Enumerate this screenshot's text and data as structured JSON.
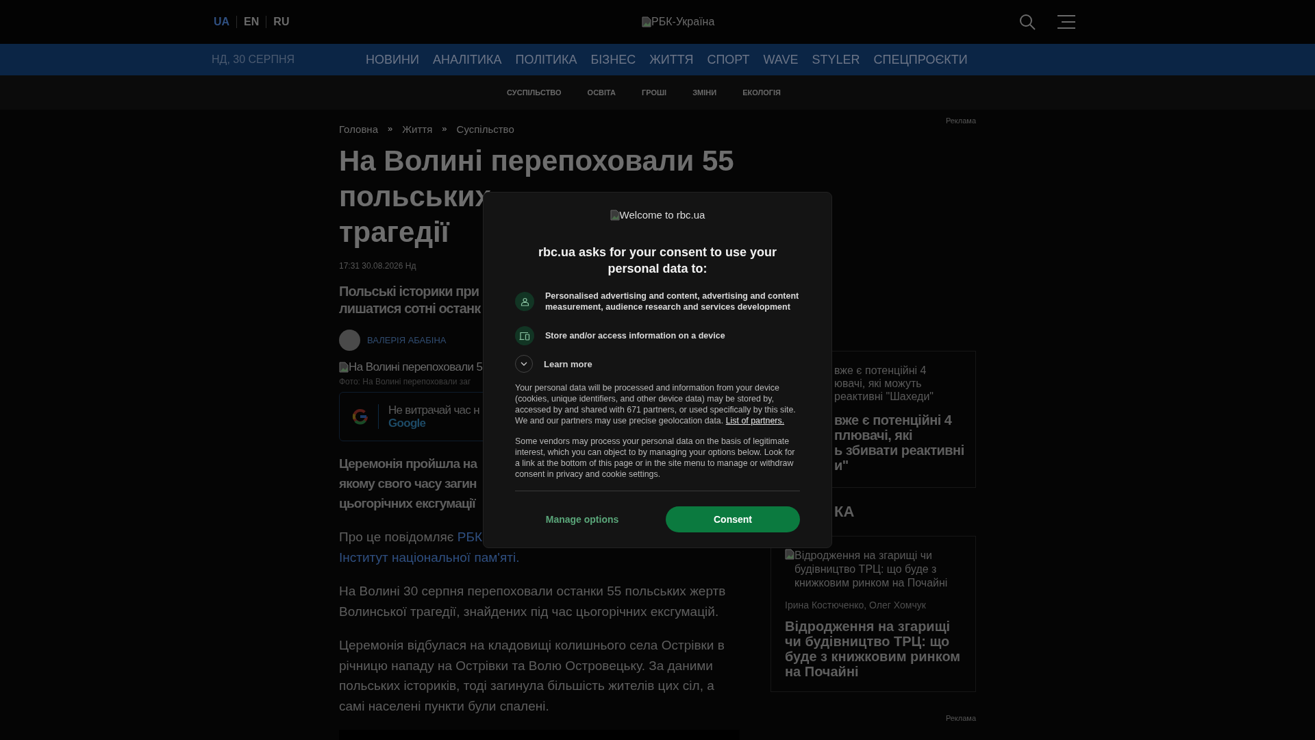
{
  "header": {
    "languages": [
      {
        "label": "UA",
        "selected": true
      },
      {
        "label": "EN",
        "selected": false
      },
      {
        "label": "RU",
        "selected": false
      }
    ],
    "logo_alt": "РБК-Україна"
  },
  "nav": {
    "date": "НД, 30 СЕРПНЯ",
    "items": [
      "НОВИНИ",
      "АНАЛІТИКА",
      "ПОЛІТИКА",
      "БІЗНЕС",
      "ЖИТТЯ",
      "СПОРТ",
      "WAVE",
      "STYLER",
      "СПЕЦПРОЄКТИ"
    ]
  },
  "subnav": [
    "СУСПІЛЬСТВО",
    "ОСВІТА",
    "ГРОШІ",
    "ЗМІНИ",
    "ЕКОЛОГІЯ"
  ],
  "breadcrumbs": [
    {
      "kind": "link",
      "text": "Головна"
    },
    {
      "kind": "separator",
      "text": "»"
    },
    {
      "kind": "link",
      "text": "Життя"
    },
    {
      "kind": "separator",
      "text": "»"
    },
    {
      "kind": "link",
      "text": "Суспільство"
    }
  ],
  "ad_labels": [
    "Реклама",
    "Реклама"
  ],
  "article": {
    "title_lines": [
      "На Волині перепоховали 55",
      "польських",
      "трагедії"
    ],
    "date": "17:31 30.08.2026 Нд",
    "lead_lines": [
      "Польські історики при",
      "лишатися сотні останк"
    ],
    "author": "ВАЛЕРІЯ АБАБІНА",
    "image_alt": "На Волині перепоховали 5",
    "photo_caption": "Фото: На Волині перепоховали заг",
    "promo": {
      "text": "Не витрачай час н",
      "link": "Google"
    },
    "bold_lines": [
      "Церемонія пройшла на",
      "якому свого часу загин",
      "цьогорічних ексгумації"
    ],
    "source": {
      "text": "Про це повідомляє",
      "links": [
        "РБК",
        "Інститут національної пам'яті."
      ]
    },
    "paragraphs": [
      "На Волині 30 серпня перепоховали останки 55 польських жертв Волинської трагедії, знайдених під час цьогорічних ексгумацій.",
      "Церемонія відбулася на кладовищі колишнього села Острівки в річницю нападу на Острівки та Волю Островецьку. За даними польських істориків, тоді загинула більшість жителів цих сіл, а самі населені пункти були спалені."
    ]
  },
  "sidebar": {
    "cards": [
      {
        "kind": "partial",
        "image_alt_lines": [
          "вже є потенційні 4",
          "ювачі, які можуть",
          "реактивні \"Шахеди\""
        ],
        "title_lines": [
          "вже є потенційні 4",
          "плювачі, які",
          "ь збивати реактивні",
          "и\""
        ]
      }
    ],
    "heading": "КА",
    "stories": [
      {
        "image_alt": "Відродження на згарищі чи будівництво ТРЦ: що буде з книжковим ринком на Почайні",
        "authors": "Ірина Костюченко, Олег Хомчук",
        "title": "Відродження на згарищі чи будівництво ТРЦ: що буде з книжковим ринком на Почайні"
      }
    ]
  },
  "consent": {
    "logo_alt": "Welcome to rbc.ua",
    "heading": "rbc.ua asks for your consent to use your personal data to:",
    "purposes": [
      {
        "kind": "person",
        "text": "Personalised advertising and content, advertising and content measurement, audience research and services development"
      },
      {
        "kind": "device",
        "text": "Store and/or access information on a device"
      }
    ],
    "learn_more": "Learn more",
    "body": [
      {
        "text": "Your personal data will be processed and information from your device (cookies, unique identifiers, and other device data) may be stored by, accessed by and shared with 671 partners, or used specifically by this site. We and our partners may use precise geolocation data.",
        "link": "List of partners."
      },
      {
        "text": "Some vendors may process your personal data on the basis of legitimate interest, which you can object to by managing your options below. Look for a link at the bottom of this page or in the site menu to manage or withdraw consent in privacy and cookie settings."
      }
    ],
    "manage": "Manage options",
    "accept": "Consent"
  }
}
